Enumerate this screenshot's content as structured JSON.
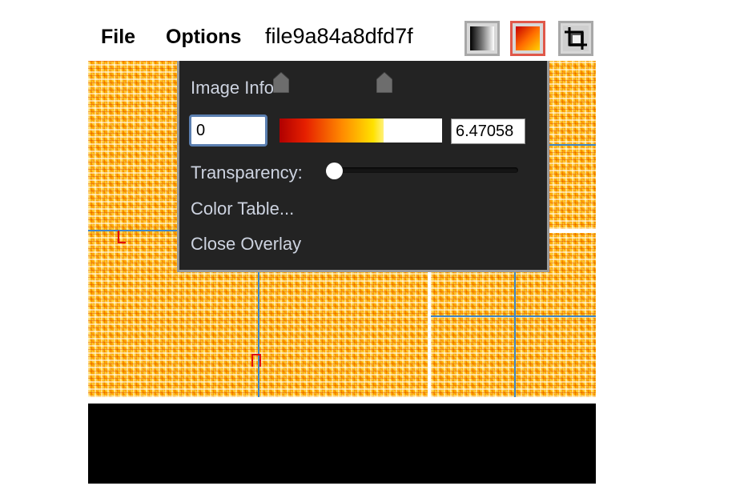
{
  "menu": {
    "file_label": "File",
    "options_label": "Options"
  },
  "document": {
    "filename": "file9a84a8dfd7f"
  },
  "toolbar": {
    "buttons": [
      {
        "name": "grayscale-colormap",
        "icon": "grayscale-gradient-icon",
        "active": false
      },
      {
        "name": "heat-colormap",
        "icon": "heat-gradient-icon",
        "active": true
      },
      {
        "name": "crop-tool",
        "icon": "crop-icon",
        "active": false
      }
    ]
  },
  "overlay": {
    "title": "Image Info",
    "range_min": "0",
    "range_max": "6.47058",
    "transparency_label": "Transparency:",
    "transparency_value": 0,
    "color_table_label": "Color Table...",
    "close_label": "Close Overlay"
  },
  "colors": {
    "overlay_bg": "#232323",
    "overlay_text": "#cdd3e0",
    "active_border": "#e0584a",
    "grid_line": "#3f86c9",
    "marker": "#e01010",
    "heatmap_base": "#ffa800"
  }
}
